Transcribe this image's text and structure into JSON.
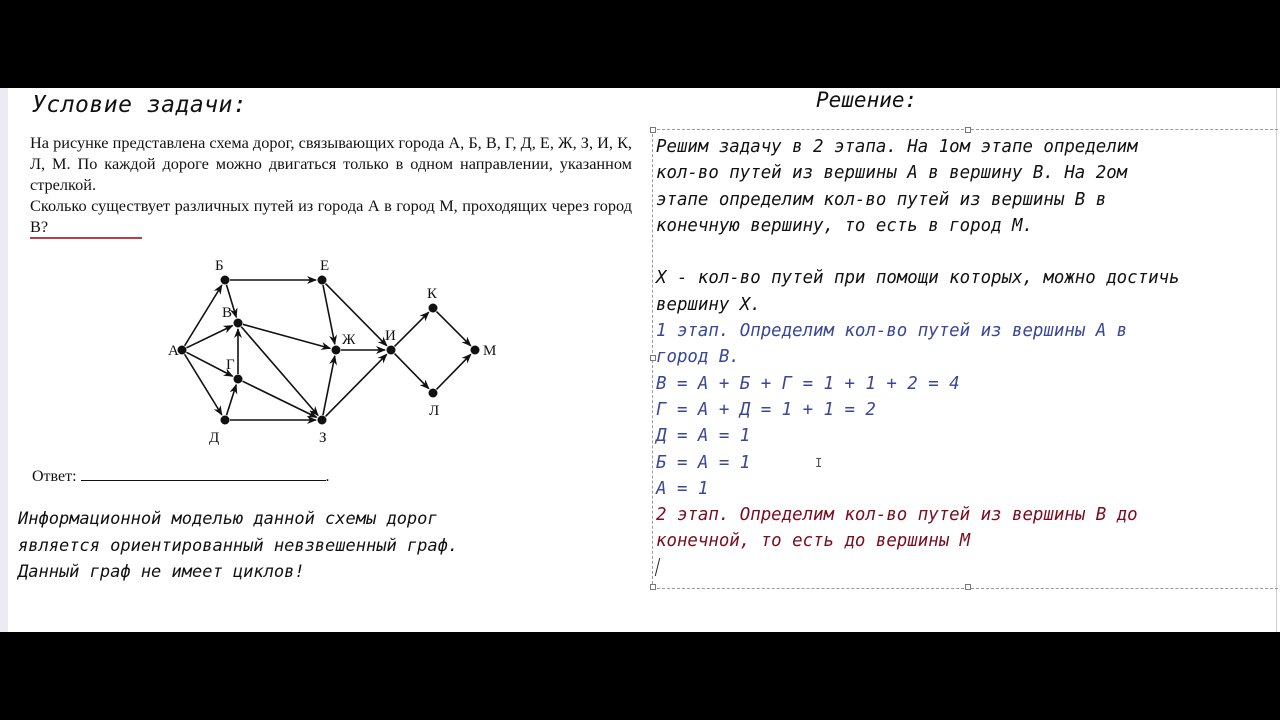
{
  "left_panel": {
    "title": "Условие задачи:",
    "problem_paragraphs": [
      "На рисунке представлена схема дорог, связывающих города А, Б, В, Г, Д, Е, Ж, З, И, К, Л, М. По каждой дороге можно двигаться только в одном направлении, указанном стрелкой.",
      "Сколько существует различных путей из города А в город М, проходящих через город В?"
    ],
    "highlight_color": "#c23a45",
    "answer_label": "Ответ:",
    "answer_suffix": ".",
    "info_lines": [
      "Информационной моделью данной схемы дорог",
      "является ориентированный невзвешенный граф.",
      "Данный граф не имеет циклов!"
    ]
  },
  "graph": {
    "nodes": [
      {
        "id": "А",
        "label": "А"
      },
      {
        "id": "Б",
        "label": "Б"
      },
      {
        "id": "В",
        "label": "В"
      },
      {
        "id": "Г",
        "label": "Г"
      },
      {
        "id": "Д",
        "label": "Д"
      },
      {
        "id": "Е",
        "label": "Е"
      },
      {
        "id": "Ж",
        "label": "Ж"
      },
      {
        "id": "З",
        "label": "З"
      },
      {
        "id": "И",
        "label": "И"
      },
      {
        "id": "К",
        "label": "К"
      },
      {
        "id": "Л",
        "label": "Л"
      },
      {
        "id": "М",
        "label": "М"
      }
    ],
    "edges": [
      [
        "А",
        "Б"
      ],
      [
        "А",
        "В"
      ],
      [
        "А",
        "Г"
      ],
      [
        "А",
        "Д"
      ],
      [
        "Б",
        "В"
      ],
      [
        "Б",
        "Е"
      ],
      [
        "Г",
        "В"
      ],
      [
        "Д",
        "Г"
      ],
      [
        "Д",
        "З"
      ],
      [
        "В",
        "Ж"
      ],
      [
        "В",
        "З"
      ],
      [
        "Г",
        "З"
      ],
      [
        "Е",
        "Ж"
      ],
      [
        "Е",
        "И"
      ],
      [
        "З",
        "Ж"
      ],
      [
        "З",
        "И"
      ],
      [
        "Ж",
        "И"
      ],
      [
        "И",
        "К"
      ],
      [
        "И",
        "Л"
      ],
      [
        "К",
        "М"
      ],
      [
        "Л",
        "М"
      ]
    ]
  },
  "right_panel": {
    "title": "Решение:",
    "colors": {
      "text": "#111111",
      "stage1": "#3a4699",
      "stage2": "#7a0c1e"
    },
    "lines": [
      {
        "text": "Решим задачу в 2 этапа. На 1ом этапе определим",
        "style": "black"
      },
      {
        "text": "кол-во путей из вершины А в вершину В. На 2ом",
        "style": "black"
      },
      {
        "text": "этапе определим кол-во путей из вершины В в",
        "style": "black"
      },
      {
        "text": "конечную вершину, то есть в город М.",
        "style": "black"
      },
      {
        "text": "",
        "style": "black"
      },
      {
        "text": "X - кол-во путей при помощи которых, можно достичь",
        "style": "black"
      },
      {
        "text": "вершину X.",
        "style": "black"
      },
      {
        "text": "1 этап. Определим кол-во путей из вершины А в",
        "style": "blue"
      },
      {
        "text": "город В.",
        "style": "blue"
      },
      {
        "text": "В = А + Б + Г = 1 + 1 + 2 = 4",
        "style": "blue"
      },
      {
        "text": "Г = А + Д = 1 + 1 = 2",
        "style": "blue"
      },
      {
        "text": "Д = А = 1",
        "style": "blue"
      },
      {
        "text": "Б = А = 1",
        "style": "blue"
      },
      {
        "text": "А = 1",
        "style": "blue"
      },
      {
        "text": "2 этап. Определим кол-во путей из вершины В до",
        "style": "red"
      },
      {
        "text": "конечной, то есть до вершины М",
        "style": "red"
      }
    ],
    "mouse_cursor": "I-beam-cursor"
  }
}
